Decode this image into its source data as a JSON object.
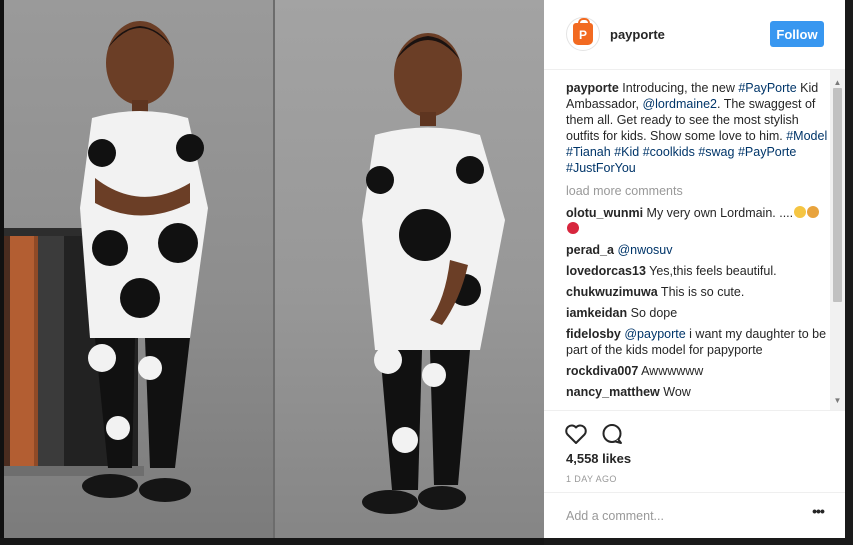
{
  "post": {
    "username": "payporte",
    "follow_label": "Follow",
    "avatar_letter": "P",
    "caption": {
      "author": "payporte",
      "parts": [
        {
          "text": " Introducing, the new ",
          "link": false
        },
        {
          "text": "#PayPorte",
          "link": true
        },
        {
          "text": " Kid Ambassador, ",
          "link": false
        },
        {
          "text": "@lordmaine2",
          "link": true
        },
        {
          "text": ". The swaggest of them all. Get ready to see the most stylish outfits for kids. Show some love to him. ",
          "link": false
        },
        {
          "text": "#Model",
          "link": true
        },
        {
          "text": " ",
          "link": false
        },
        {
          "text": "#Tianah",
          "link": true
        },
        {
          "text": " ",
          "link": false
        },
        {
          "text": "#Kid",
          "link": true
        },
        {
          "text": " ",
          "link": false
        },
        {
          "text": "#coolkids",
          "link": true
        },
        {
          "text": " ",
          "link": false
        },
        {
          "text": "#swag",
          "link": true
        },
        {
          "text": " ",
          "link": false
        },
        {
          "text": "#PayPorte",
          "link": true
        },
        {
          "text": " ",
          "link": false
        },
        {
          "text": "#JustForYou",
          "link": true
        }
      ]
    },
    "load_more_label": "load more comments",
    "comments": [
      {
        "author": "olotu_wunmi",
        "parts": [
          {
            "text": " My very own Lordmain. ....",
            "link": false
          }
        ],
        "emojis": [
          "#f5c542",
          "#e8a33d",
          "#d7263d"
        ]
      },
      {
        "author": "perad_a",
        "parts": [
          {
            "text": " ",
            "link": false
          },
          {
            "text": "@nwosuv",
            "link": true
          }
        ],
        "emojis": []
      },
      {
        "author": "lovedorcas13",
        "parts": [
          {
            "text": " Yes,this feels beautiful.",
            "link": false
          }
        ],
        "emojis": []
      },
      {
        "author": "chukwuzimuwa",
        "parts": [
          {
            "text": " This is so cute.",
            "link": false
          }
        ],
        "emojis": []
      },
      {
        "author": "iamkeidan",
        "parts": [
          {
            "text": " So dope",
            "link": false
          }
        ],
        "emojis": []
      },
      {
        "author": "fidelosby",
        "parts": [
          {
            "text": " ",
            "link": false
          },
          {
            "text": "@payporte",
            "link": true
          },
          {
            "text": " i want my daughter to be part of the kids model for papyporte",
            "link": false
          }
        ],
        "emojis": []
      },
      {
        "author": "rockdiva007",
        "parts": [
          {
            "text": " Awwwwww",
            "link": false
          }
        ],
        "emojis": []
      },
      {
        "author": "nancy_matthew",
        "parts": [
          {
            "text": " Wow",
            "link": false
          }
        ],
        "emojis": []
      }
    ],
    "likes": "4,558 likes",
    "time": "1 DAY AGO",
    "comment_placeholder": "Add a comment...",
    "more_options": "•••"
  },
  "colors": {
    "follow": "#3897f0",
    "link": "#003569",
    "brand": "#f26a21"
  },
  "icons": {
    "like": "heart-icon",
    "comment": "speech-bubble-icon",
    "scroll_up": "triangle-up-icon",
    "scroll_down": "triangle-down-icon"
  }
}
